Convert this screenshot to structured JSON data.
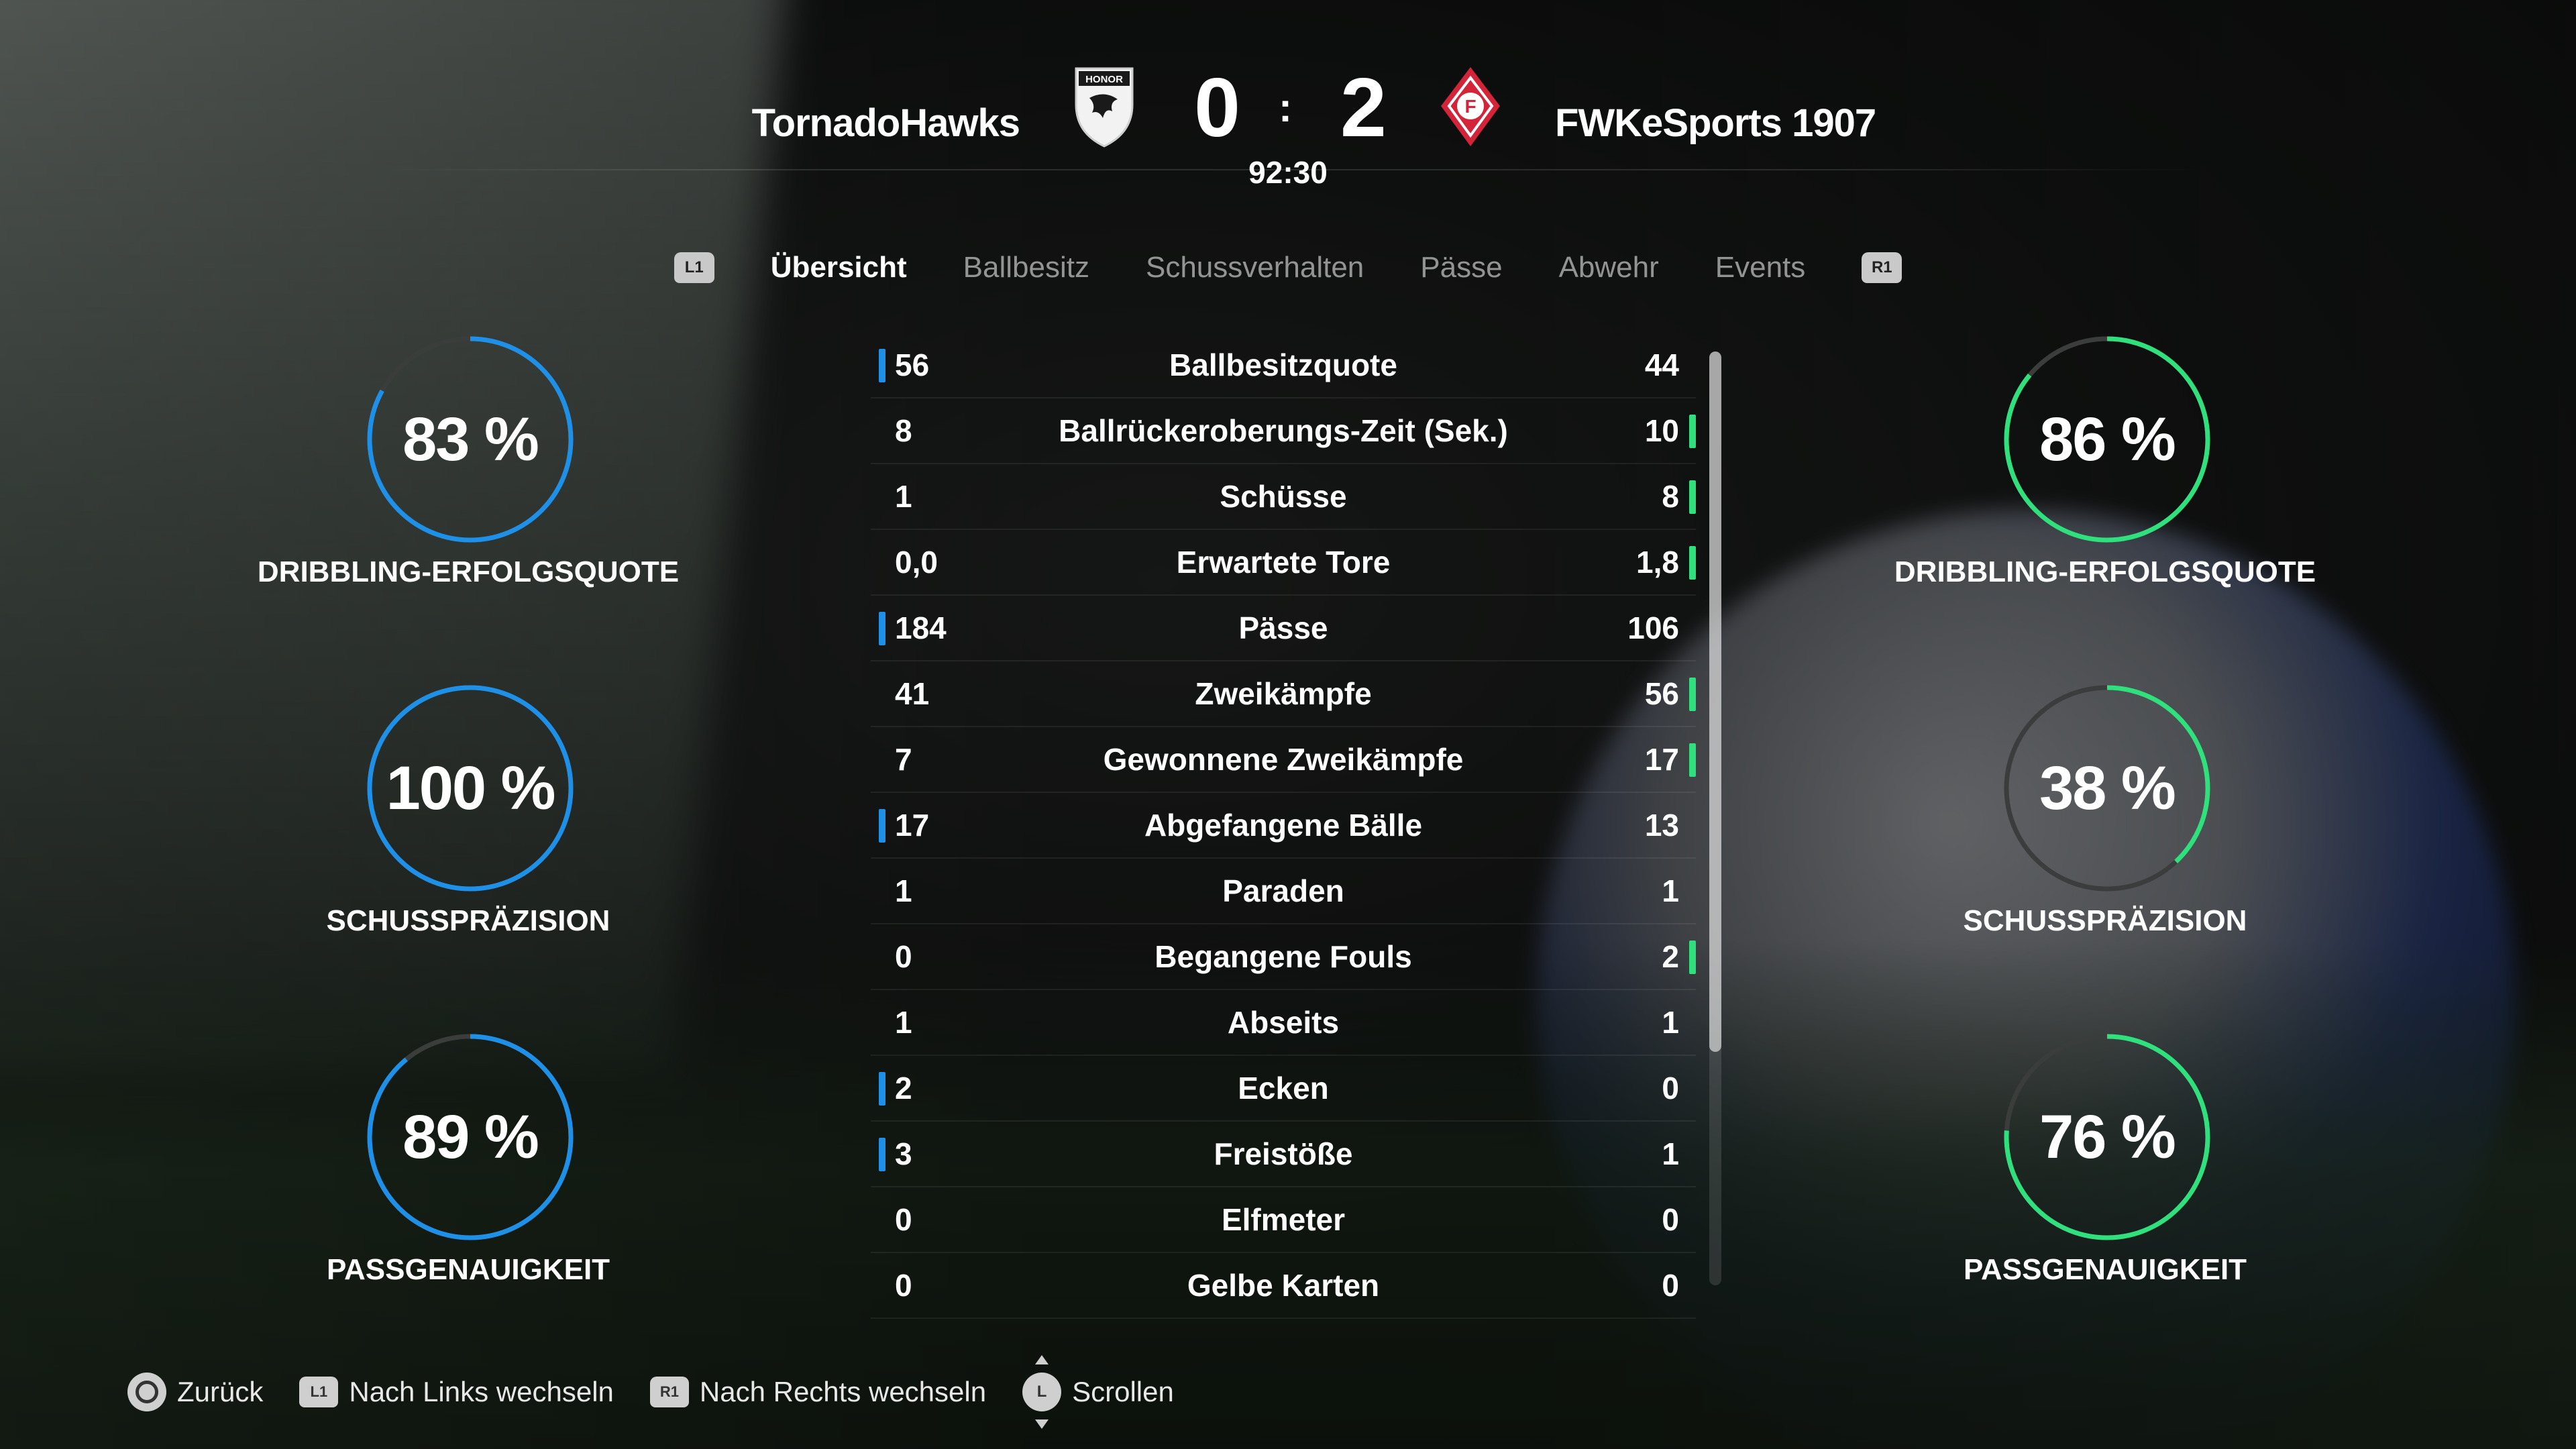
{
  "match": {
    "home_team": "TornadoHawks",
    "away_team": "FWKeSports 1907",
    "home_score": "0",
    "away_score": "2",
    "separator": ":",
    "clock": "92:30",
    "home_crest_text": "HONOR",
    "away_crest_text": "F"
  },
  "tabs": {
    "left_bumper": "L1",
    "right_bumper": "R1",
    "items": [
      "Übersicht",
      "Ballbesitz",
      "Schussverhalten",
      "Pässe",
      "Abwehr",
      "Events"
    ],
    "active_index": 0
  },
  "stats": [
    {
      "label": "Ballbesitzquote",
      "home": "56",
      "away": "44",
      "leader": "home"
    },
    {
      "label": "Ballrückeroberungs-Zeit (Sek.)",
      "home": "8",
      "away": "10",
      "leader": "away"
    },
    {
      "label": "Schüsse",
      "home": "1",
      "away": "8",
      "leader": "away"
    },
    {
      "label": "Erwartete Tore",
      "home": "0,0",
      "away": "1,8",
      "leader": "away"
    },
    {
      "label": "Pässe",
      "home": "184",
      "away": "106",
      "leader": "home"
    },
    {
      "label": "Zweikämpfe",
      "home": "41",
      "away": "56",
      "leader": "away"
    },
    {
      "label": "Gewonnene Zweikämpfe",
      "home": "7",
      "away": "17",
      "leader": "away"
    },
    {
      "label": "Abgefangene Bälle",
      "home": "17",
      "away": "13",
      "leader": "home"
    },
    {
      "label": "Paraden",
      "home": "1",
      "away": "1",
      "leader": "none"
    },
    {
      "label": "Begangene Fouls",
      "home": "0",
      "away": "2",
      "leader": "away"
    },
    {
      "label": "Abseits",
      "home": "1",
      "away": "1",
      "leader": "none"
    },
    {
      "label": "Ecken",
      "home": "2",
      "away": "0",
      "leader": "home"
    },
    {
      "label": "Freistöße",
      "home": "3",
      "away": "1",
      "leader": "home"
    },
    {
      "label": "Elfmeter",
      "home": "0",
      "away": "0",
      "leader": "none"
    },
    {
      "label": "Gelbe Karten",
      "home": "0",
      "away": "0",
      "leader": "none"
    }
  ],
  "rings": {
    "home": [
      {
        "value": "83 %",
        "percent": 83,
        "label": "DRIBBLING-ERFOLGSQUOTE"
      },
      {
        "value": "100 %",
        "percent": 100,
        "label": "SCHUSSPRÄZISION"
      },
      {
        "value": "89 %",
        "percent": 89,
        "label": "PASSGENAUIGKEIT"
      }
    ],
    "away": [
      {
        "value": "86 %",
        "percent": 86,
        "label": "DRIBBLING-ERFOLGSQUOTE"
      },
      {
        "value": "38 %",
        "percent": 38,
        "label": "SCHUSSPRÄZISION"
      },
      {
        "value": "76 %",
        "percent": 76,
        "label": "PASSGENAUIGKEIT"
      }
    ]
  },
  "colors": {
    "home_accent": "#1e90e8",
    "away_accent": "#2fe07d",
    "ring_track": "#3a3d3c"
  },
  "scroll": {
    "position": 0,
    "visible_fraction": 0.75
  },
  "footer": {
    "back_label": "Zurück",
    "left_label": "Nach Links wechseln",
    "right_label": "Nach Rechts wechseln",
    "scroll_label": "Scrollen",
    "left_button": "L1",
    "right_button": "R1",
    "stick_button": "L"
  }
}
